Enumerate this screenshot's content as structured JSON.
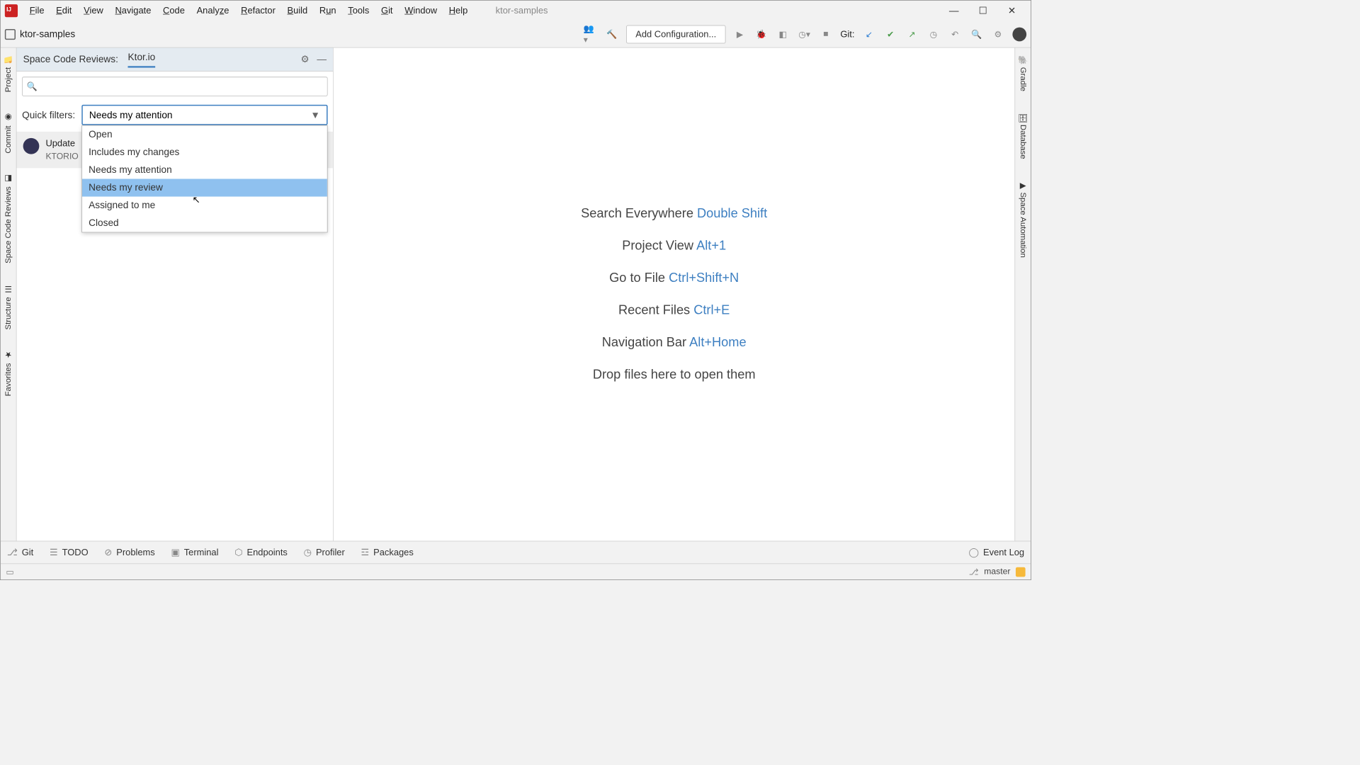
{
  "menu": {
    "items": [
      "File",
      "Edit",
      "View",
      "Navigate",
      "Code",
      "Analyze",
      "Refactor",
      "Build",
      "Run",
      "Tools",
      "Git",
      "Window",
      "Help"
    ]
  },
  "title": "ktor-samples",
  "toolbar": {
    "breadcrumb": "ktor-samples",
    "config": "Add Configuration...",
    "git_label": "Git:"
  },
  "panel": {
    "title": "Space Code Reviews:",
    "tab": "Ktor.io",
    "filter_label": "Quick filters:",
    "filter_value": "Needs my attention",
    "filter_options": [
      "Open",
      "Includes my changes",
      "Needs my attention",
      "Needs my review",
      "Assigned to me",
      "Closed"
    ],
    "filter_highlight_index": 3,
    "review": {
      "title": "Update",
      "sub": "KTORIO"
    }
  },
  "editor_hints": [
    {
      "label": "Search Everywhere",
      "shortcut": "Double Shift"
    },
    {
      "label": "Project View",
      "shortcut": "Alt+1"
    },
    {
      "label": "Go to File",
      "shortcut": "Ctrl+Shift+N"
    },
    {
      "label": "Recent Files",
      "shortcut": "Ctrl+E"
    },
    {
      "label": "Navigation Bar",
      "shortcut": "Alt+Home"
    }
  ],
  "editor_drop": "Drop files here to open them",
  "left_tabs": [
    "Project",
    "Commit",
    "Space Code Reviews",
    "Structure",
    "Favorites"
  ],
  "right_tabs": [
    "Gradle",
    "Database",
    "Space Automation"
  ],
  "bottom": {
    "items": [
      {
        "icon": "⎇",
        "label": "Git"
      },
      {
        "icon": "☰",
        "label": "TODO"
      },
      {
        "icon": "⊘",
        "label": "Problems"
      },
      {
        "icon": "▣",
        "label": "Terminal"
      },
      {
        "icon": "⬡",
        "label": "Endpoints"
      },
      {
        "icon": "◷",
        "label": "Profiler"
      },
      {
        "icon": "☲",
        "label": "Packages"
      }
    ],
    "event_log": "Event Log"
  },
  "status": {
    "branch": "master"
  }
}
